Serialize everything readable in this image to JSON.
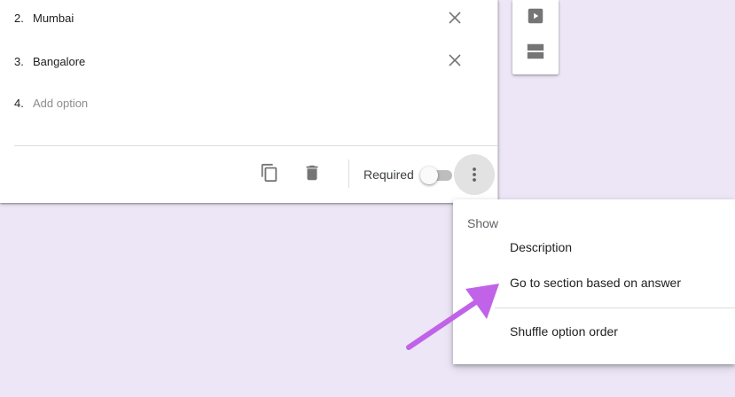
{
  "options": [
    {
      "number": "2.",
      "text": "Mumbai"
    },
    {
      "number": "3.",
      "text": "Bangalore"
    }
  ],
  "add_option": {
    "number": "4.",
    "placeholder": "Add option"
  },
  "footer": {
    "duplicate_icon": "copy-icon",
    "delete_icon": "trash-icon",
    "required_label": "Required",
    "required_on": false,
    "more_icon": "more-vert-icon"
  },
  "side_toolbar": {
    "icons": [
      "video-icon",
      "section-icon"
    ]
  },
  "menu": {
    "header": "Show",
    "items": [
      {
        "label": "Description"
      },
      {
        "label": "Go to section based on answer"
      },
      {
        "label": "Shuffle option order"
      }
    ]
  },
  "colors": {
    "background": "#ece6f6",
    "arrow": "#c063e8",
    "icon": "#757575"
  }
}
